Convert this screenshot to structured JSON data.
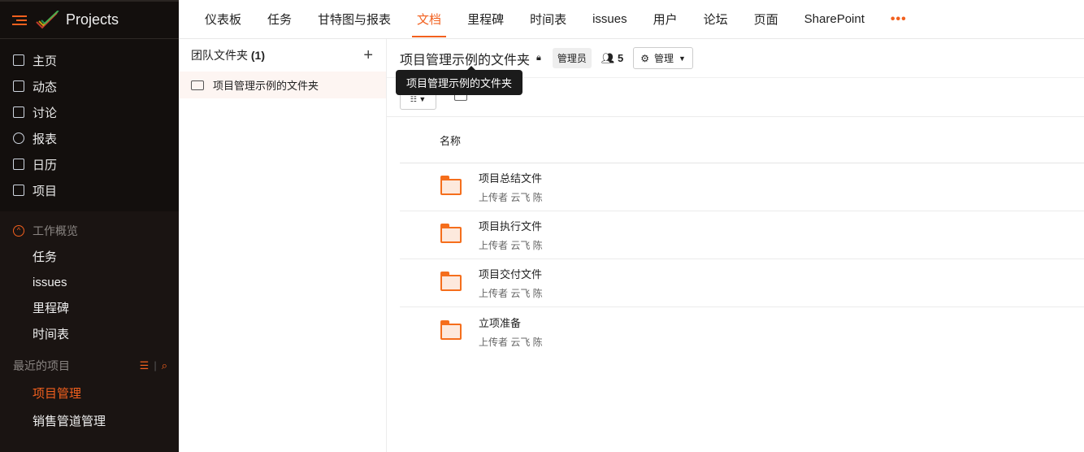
{
  "app": {
    "title": "Projects"
  },
  "sidebar": {
    "items": [
      {
        "label": "主页",
        "icon": "home-icon"
      },
      {
        "label": "动态",
        "icon": "feed-icon"
      },
      {
        "label": "讨论",
        "icon": "discussion-icon"
      },
      {
        "label": "报表",
        "icon": "reports-icon"
      },
      {
        "label": "日历",
        "icon": "calendar-icon"
      },
      {
        "label": "项目",
        "icon": "briefcase-icon"
      }
    ],
    "work_overview": {
      "label": "工作概览",
      "items": [
        "任务",
        "issues",
        "里程碑",
        "时间表"
      ]
    },
    "recent": {
      "label": "最近的项目",
      "projects": [
        "项目管理",
        "销售管道管理"
      ]
    }
  },
  "topnav": {
    "tabs": [
      "仪表板",
      "任务",
      "甘特图与报表",
      "文档",
      "里程碑",
      "时间表",
      "issues",
      "用户",
      "论坛",
      "页面",
      "SharePoint"
    ],
    "active": "文档",
    "more": "•••"
  },
  "left_panel": {
    "title": "团队文件夹",
    "count": "(1)",
    "folders": [
      "项目管理示例的文件夹"
    ]
  },
  "main": {
    "title": "项目管理示例的文件夹",
    "role_badge": "管理员",
    "members": "5",
    "manage_label": "管理",
    "tooltip": "项目管理示例的文件夹",
    "column_name": "名称",
    "rows": [
      {
        "name": "项目总结文件",
        "sub": "上传者 云飞 陈"
      },
      {
        "name": "项目执行文件",
        "sub": "上传者 云飞 陈"
      },
      {
        "name": "项目交付文件",
        "sub": "上传者 云飞 陈"
      },
      {
        "name": "立项准备",
        "sub": "上传者 云飞 陈"
      }
    ]
  },
  "colors": {
    "accent": "#f2601e",
    "sidebar": "#1a1412"
  }
}
